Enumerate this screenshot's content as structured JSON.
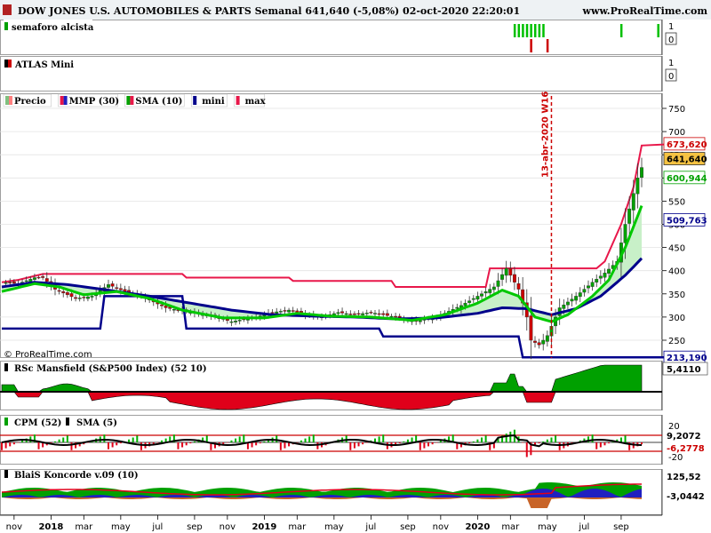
{
  "header": {
    "title": "DOW JONES U.S. AUTOMOBILES & PARTS Semanal 641,640 (-5,08%) 02-oct-2020 22:20:01",
    "site": "www.ProRealTime.com",
    "copyright": "© ProRealTime.com"
  },
  "colors": {
    "bg": "#ffffff",
    "grid": "#d0d0d0",
    "up_candle": "#00a000",
    "down_candle": "#cc0000",
    "red_line": "#e8174a",
    "green_line": "#00c800",
    "blue_line": "#00008b",
    "fill_green": "#c8f0c8",
    "fill_red": "#f0c8d0",
    "mansfield_pos": "#00a000",
    "mansfield_neg": "#e0001a"
  },
  "panels": {
    "semaforo": {
      "label": "semaforo alcista",
      "ticks": [
        "1",
        "0"
      ]
    },
    "atlas": {
      "label": "ATLAS Mini",
      "ticks": [
        "1",
        "0"
      ]
    },
    "price": {
      "legend": [
        "Precio",
        "MMP (30)",
        "SMA (10)",
        "mini",
        "max"
      ],
      "annotation": "13-abr-2020 W16"
    },
    "mansfield": {
      "label": "RSc Mansfield (S&P500 Index) (52 10)",
      "value": "5,4110"
    },
    "cpm": {
      "labels": [
        "CPM (52)",
        "SMA (5)"
      ],
      "ticks": [
        "20",
        "-20"
      ],
      "val1": "9,2072",
      "val2": "-6,2778"
    },
    "koncorde": {
      "label": "BlaiS Koncorde v.09 (10)",
      "val1": "125,52",
      "val2": "-3,0442"
    }
  },
  "xaxis_labels": [
    "nov",
    "2018",
    "mar",
    "may",
    "jul",
    "sep",
    "nov",
    "2019",
    "mar",
    "may",
    "jul",
    "sep",
    "nov",
    "2020",
    "mar",
    "may",
    "jul",
    "sep"
  ],
  "chart_data": {
    "type": "line",
    "title": "DOW JONES U.S. AUTOMOBILES & PARTS Semanal",
    "xlabel": "",
    "ylabel": "",
    "ylim": [
      180,
      780
    ],
    "yticks": [
      250,
      300,
      350,
      400,
      450,
      500,
      550,
      600,
      650,
      700,
      750
    ],
    "weeks": 156,
    "x_tick_labels": [
      "nov",
      "2018",
      "mar",
      "may",
      "jul",
      "sep",
      "nov",
      "2019",
      "mar",
      "may",
      "jul",
      "sep",
      "nov",
      "2020",
      "mar",
      "may",
      "jul",
      "sep"
    ],
    "value_tags": [
      {
        "name": "max",
        "value": "673,620"
      },
      {
        "name": "Precio",
        "value": "641,640"
      },
      {
        "name": "SMA (10)",
        "value": "600,944"
      },
      {
        "name": "MMP (30)",
        "value": "509,763"
      },
      {
        "name": "mini",
        "value": "213,190"
      }
    ],
    "close_keypoints": [
      [
        0,
        375
      ],
      [
        4,
        372
      ],
      [
        8,
        385
      ],
      [
        10,
        385
      ],
      [
        13,
        360
      ],
      [
        18,
        340
      ],
      [
        22,
        345
      ],
      [
        26,
        370
      ],
      [
        30,
        355
      ],
      [
        34,
        345
      ],
      [
        40,
        320
      ],
      [
        46,
        310
      ],
      [
        52,
        300
      ],
      [
        56,
        290
      ],
      [
        62,
        300
      ],
      [
        66,
        310
      ],
      [
        70,
        315
      ],
      [
        74,
        305
      ],
      [
        78,
        300
      ],
      [
        82,
        310
      ],
      [
        86,
        305
      ],
      [
        90,
        310
      ],
      [
        96,
        300
      ],
      [
        100,
        290
      ],
      [
        106,
        300
      ],
      [
        112,
        325
      ],
      [
        116,
        345
      ],
      [
        120,
        365
      ],
      [
        123,
        405
      ],
      [
        126,
        360
      ],
      [
        128,
        300
      ],
      [
        129,
        250
      ],
      [
        131,
        240
      ],
      [
        133,
        260
      ],
      [
        136,
        320
      ],
      [
        140,
        345
      ],
      [
        144,
        375
      ],
      [
        147,
        395
      ],
      [
        150,
        420
      ],
      [
        152,
        500
      ],
      [
        155,
        600
      ],
      [
        159,
        690
      ],
      [
        161,
        680
      ],
      [
        163,
        660
      ],
      [
        165,
        642
      ]
    ],
    "series": [
      {
        "name": "max",
        "points": [
          [
            0,
            375
          ],
          [
            4,
            380
          ],
          [
            10,
            393
          ],
          [
            20,
            393
          ],
          [
            44,
            393
          ],
          [
            45,
            385
          ],
          [
            70,
            385
          ],
          [
            71,
            378
          ],
          [
            95,
            378
          ],
          [
            96,
            365
          ],
          [
            118,
            365
          ],
          [
            119,
            405
          ],
          [
            145,
            405
          ],
          [
            147,
            420
          ],
          [
            151,
            500
          ],
          [
            154,
            580
          ],
          [
            156,
            670
          ],
          [
            165,
            673.6
          ]
        ]
      },
      {
        "name": "mini",
        "points": [
          [
            0,
            275
          ],
          [
            24,
            275
          ],
          [
            25,
            345
          ],
          [
            44,
            345
          ],
          [
            45,
            275
          ],
          [
            92,
            275
          ],
          [
            93,
            258
          ],
          [
            126,
            258
          ],
          [
            127,
            213.19
          ],
          [
            165,
            213.19
          ]
        ]
      },
      {
        "name": "SMA (10)",
        "points": [
          [
            0,
            355
          ],
          [
            8,
            372
          ],
          [
            14,
            365
          ],
          [
            20,
            348
          ],
          [
            28,
            355
          ],
          [
            36,
            340
          ],
          [
            44,
            315
          ],
          [
            54,
            298
          ],
          [
            64,
            298
          ],
          [
            72,
            308
          ],
          [
            80,
            302
          ],
          [
            90,
            300
          ],
          [
            100,
            293
          ],
          [
            108,
            305
          ],
          [
            116,
            330
          ],
          [
            122,
            358
          ],
          [
            126,
            345
          ],
          [
            130,
            300
          ],
          [
            134,
            290
          ],
          [
            138,
            305
          ],
          [
            144,
            345
          ],
          [
            148,
            380
          ],
          [
            152,
            450
          ],
          [
            156,
            540
          ],
          [
            160,
            620
          ],
          [
            165,
            600.944
          ]
        ]
      },
      {
        "name": "MMP (30)",
        "points": [
          [
            0,
            365
          ],
          [
            8,
            375
          ],
          [
            16,
            370
          ],
          [
            26,
            358
          ],
          [
            36,
            345
          ],
          [
            46,
            330
          ],
          [
            56,
            315
          ],
          [
            66,
            305
          ],
          [
            76,
            302
          ],
          [
            86,
            300
          ],
          [
            96,
            296
          ],
          [
            106,
            298
          ],
          [
            116,
            308
          ],
          [
            122,
            320
          ],
          [
            128,
            318
          ],
          [
            134,
            305
          ],
          [
            140,
            318
          ],
          [
            146,
            345
          ],
          [
            152,
            390
          ],
          [
            158,
            445
          ],
          [
            165,
            509.763
          ]
        ]
      }
    ],
    "annotations": [
      {
        "text": "13-abr-2020 W16",
        "week": 134
      }
    ],
    "semaforo_green_weeks": [
      125,
      126,
      127,
      128,
      129,
      130,
      131,
      132,
      151,
      160
    ],
    "semaforo_red_weeks": [
      129,
      133
    ]
  }
}
